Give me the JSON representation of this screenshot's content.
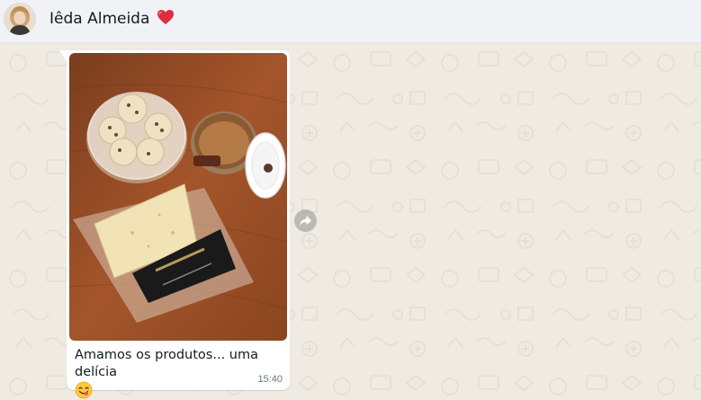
{
  "header": {
    "contact_name": "Iêda Almeida",
    "name_emoji": "red-heart-icon",
    "avatar": "contact-avatar"
  },
  "message": {
    "image": "shared-photo",
    "caption": "Amamos os produtos... uma delícia",
    "caption_emoji": "yum-face-emoji",
    "time": "15:40"
  },
  "actions": {
    "forward_icon": "forward-arrow-icon"
  },
  "colors": {
    "header_bg": "#f0f2f5",
    "chat_bg": "#efeae2",
    "bubble_bg": "#ffffff",
    "text": "#111b21",
    "meta": "#667781"
  }
}
